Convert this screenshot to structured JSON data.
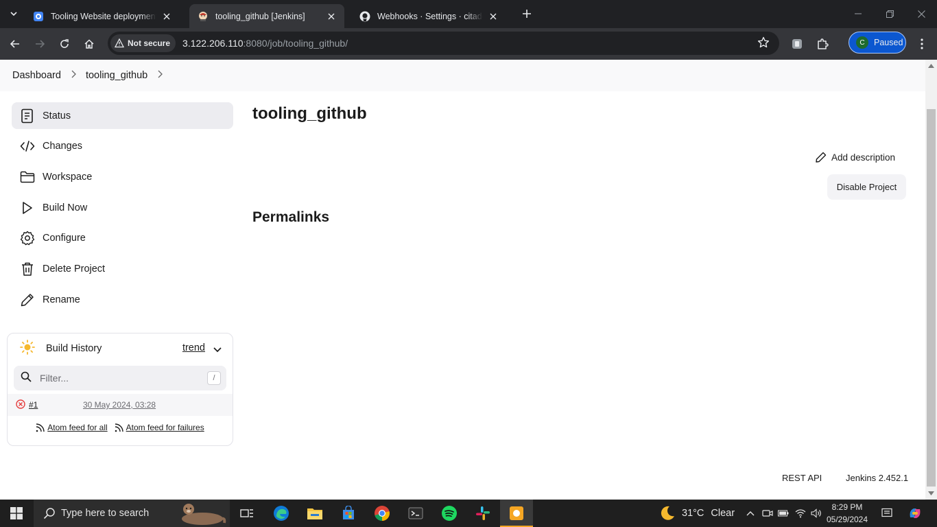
{
  "browser": {
    "tabs": [
      {
        "title": "Tooling Website deployment au",
        "active": false
      },
      {
        "title": "tooling_github [Jenkins]",
        "active": true
      },
      {
        "title": "Webhooks · Settings · citadelict",
        "active": false
      }
    ],
    "security_label": "Not secure",
    "url_host": "3.122.206.110",
    "url_path": ":8080/job/tooling_github/",
    "profile_initial": "C",
    "profile_label": "Paused"
  },
  "breadcrumb": {
    "items": [
      "Dashboard",
      "tooling_github"
    ]
  },
  "sidenav": {
    "items": [
      {
        "label": "Status",
        "icon": "status-icon",
        "active": true
      },
      {
        "label": "Changes",
        "icon": "code-icon"
      },
      {
        "label": "Workspace",
        "icon": "folder-icon"
      },
      {
        "label": "Build Now",
        "icon": "play-icon"
      },
      {
        "label": "Configure",
        "icon": "gear-icon"
      },
      {
        "label": "Delete Project",
        "icon": "trash-icon"
      },
      {
        "label": "Rename",
        "icon": "pencil-icon"
      }
    ]
  },
  "build_history": {
    "title": "Build History",
    "trend_label": "trend",
    "filter_placeholder": "Filter...",
    "filter_shortcut": "/",
    "builds": [
      {
        "number": "#1",
        "date": "30 May 2024, 03:28",
        "status": "failed"
      }
    ],
    "feed_all": "Atom feed for all",
    "feed_failures": "Atom feed for failures"
  },
  "main": {
    "title": "tooling_github",
    "add_description": "Add description",
    "disable_button": "Disable Project",
    "permalinks_heading": "Permalinks"
  },
  "footer": {
    "rest_api": "REST API",
    "version": "Jenkins 2.452.1"
  },
  "taskbar": {
    "search_placeholder": "Type here to search",
    "weather_temp": "31°C",
    "weather_cond": "Clear",
    "time": "8:29 PM",
    "date": "05/29/2024"
  },
  "colors": {
    "failed": "#e53e3e",
    "chrome_dark": "#202124",
    "profile_blue": "#0b57d0"
  }
}
